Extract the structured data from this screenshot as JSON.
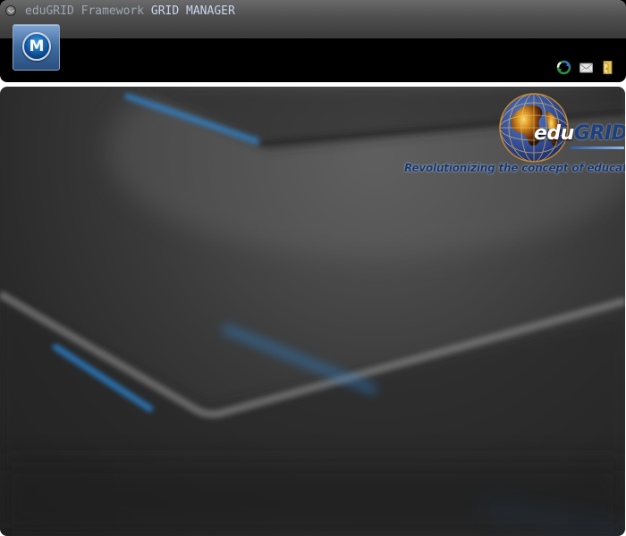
{
  "window": {
    "app_name": "eduGRID Framework",
    "section": "GRID MANAGER"
  },
  "menu_button": {
    "letter": "M"
  },
  "tray": {
    "icons": [
      "network-sync-icon",
      "mail-icon",
      "folder-icon"
    ]
  },
  "logo": {
    "brand_edu": "edu",
    "brand_grid": "GRID",
    "tagline": "Revolutionizing the concept of education"
  },
  "colors": {
    "title_bar": "#4e4e4e",
    "menu_button": "#3f6b9f",
    "desktop": "#2e2e2e",
    "accent_glow": "#2a8fe0",
    "logo_blue": "#1e3f7a"
  }
}
